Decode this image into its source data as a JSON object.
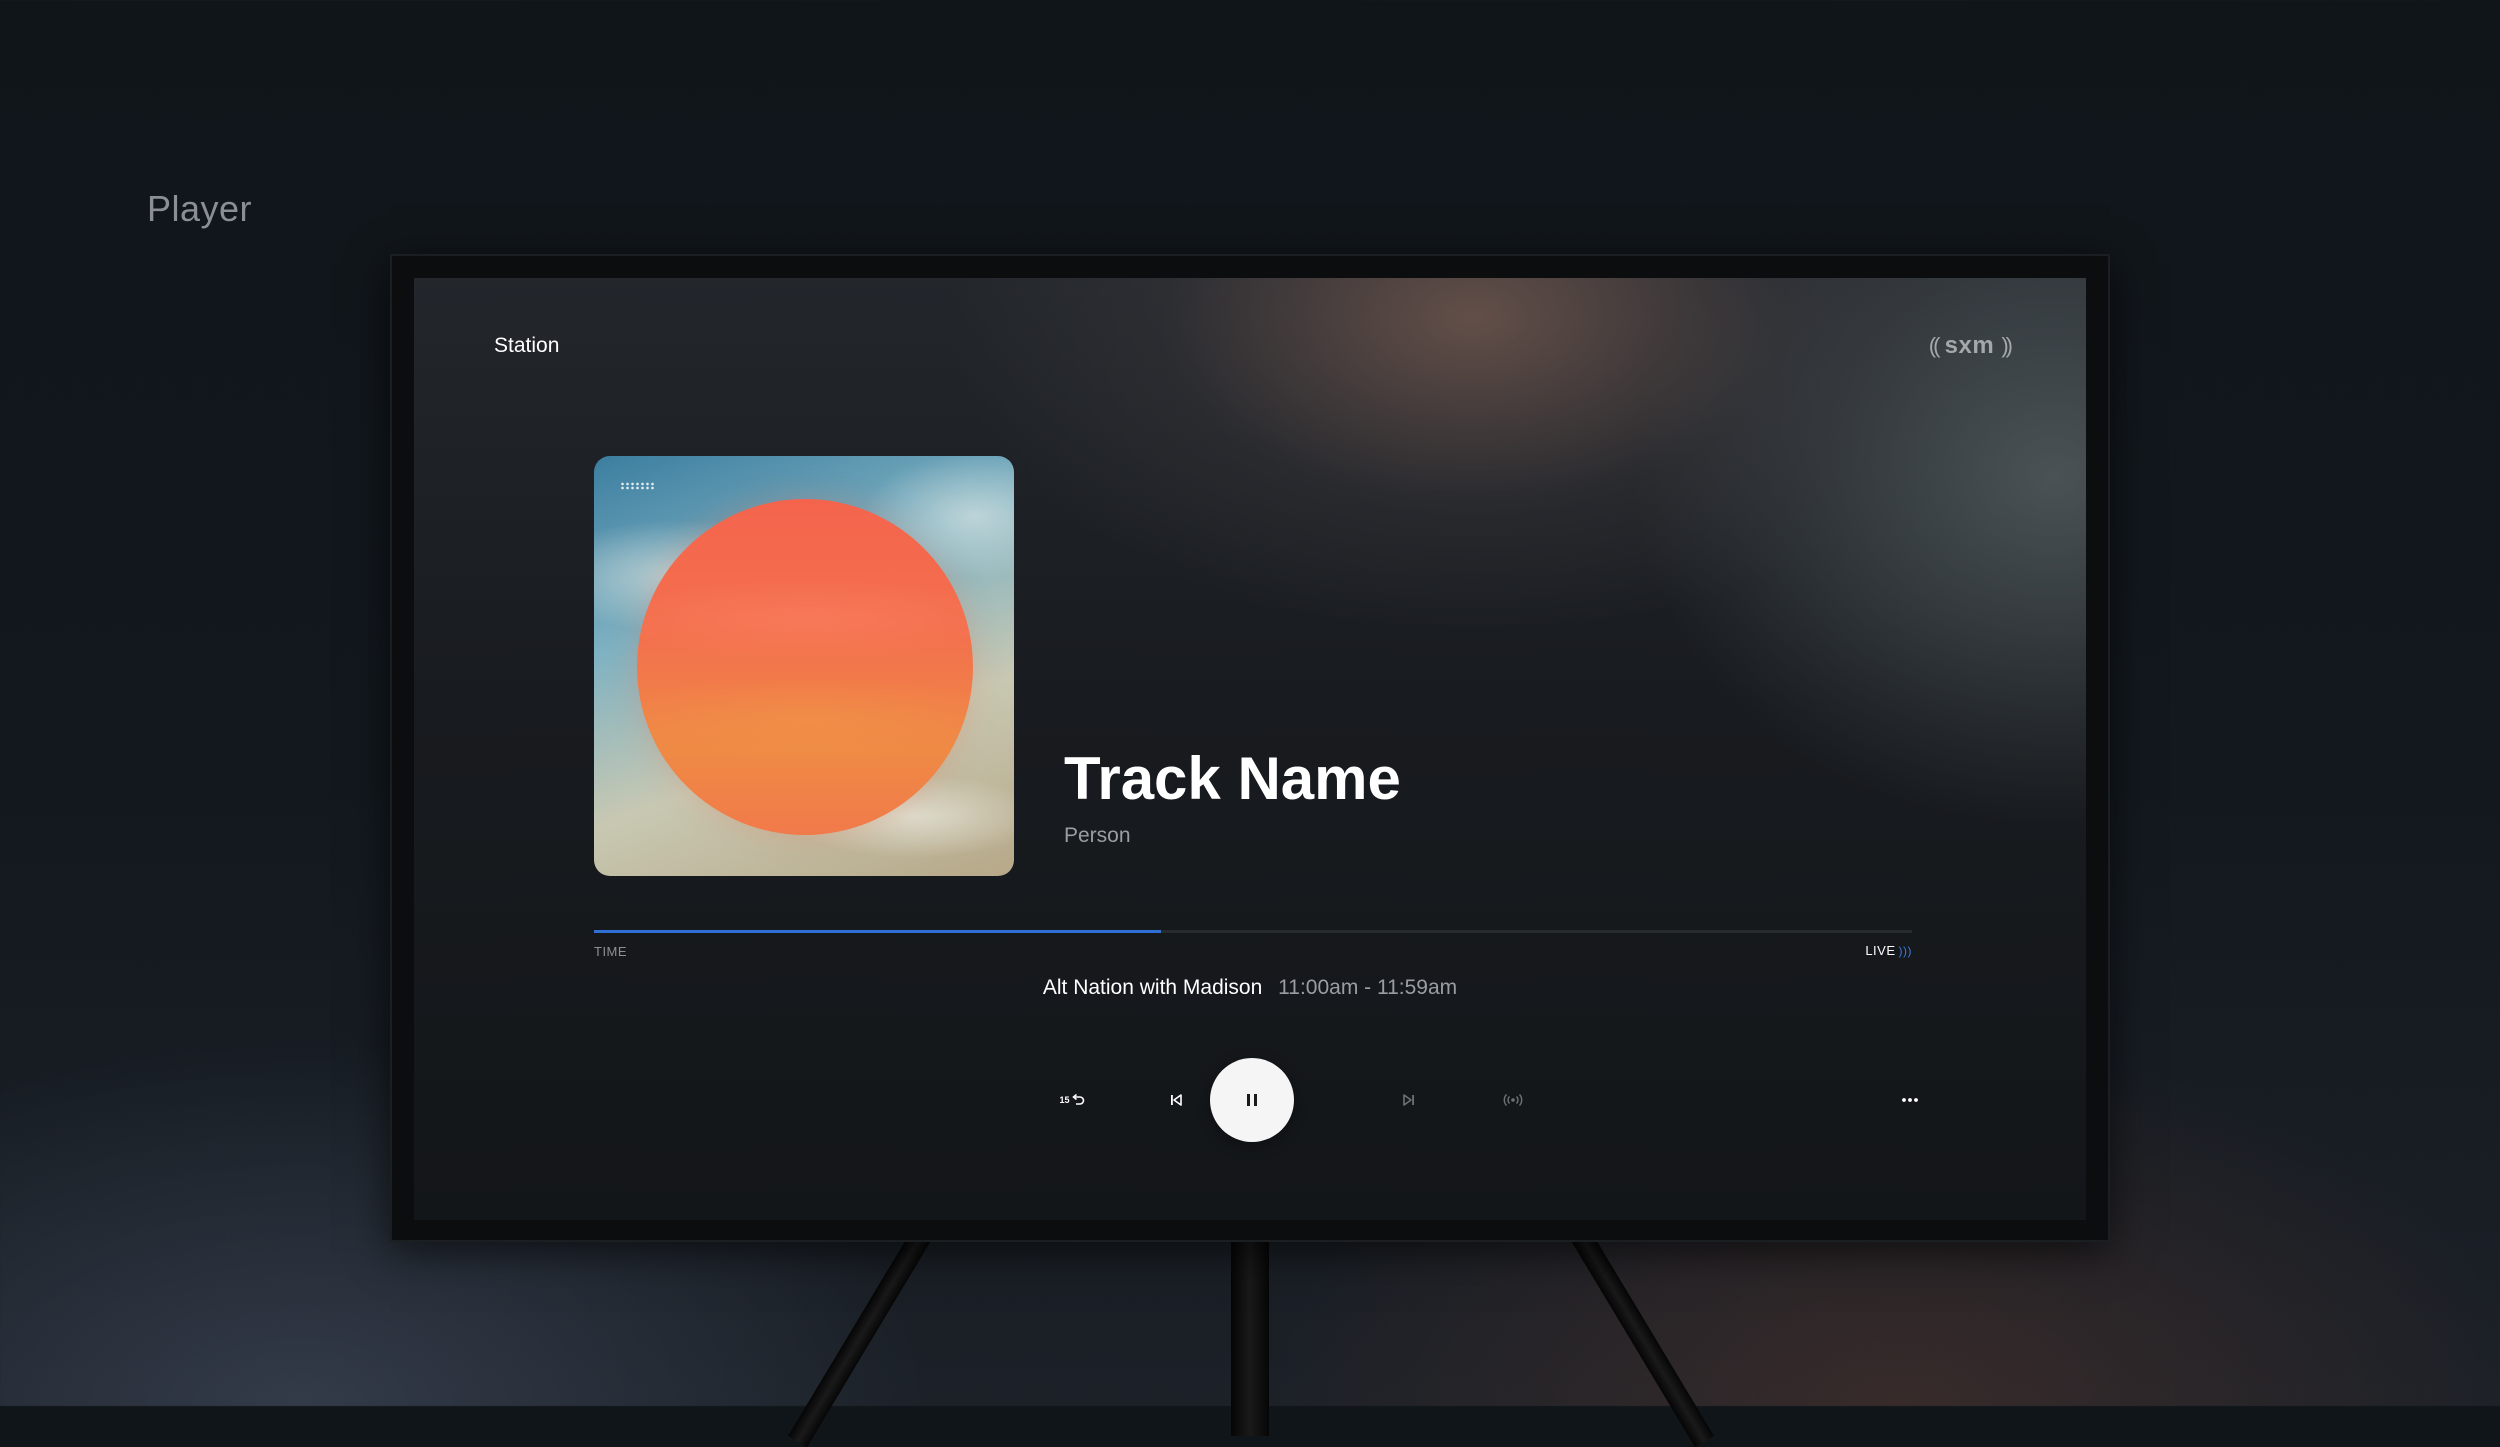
{
  "page": {
    "title": "Player"
  },
  "header": {
    "station_label": "Station",
    "logo_text": "sxm",
    "logo_wave_left": "((",
    "logo_wave_right": "))"
  },
  "now_playing": {
    "track_name": "Track Name",
    "artist_name": "Person",
    "progress_fraction": 0.43
  },
  "timeline": {
    "time_label": "TIME",
    "live_label": "LIVE",
    "live_icon": "broadcast-wave-icon"
  },
  "show": {
    "name": "Alt Nation with Madison",
    "time": "11:00am - 11:59am"
  },
  "controls": {
    "replay_amount": "15",
    "replay_icon": "rewind-15-icon",
    "previous_icon": "skip-previous-icon",
    "pause_icon": "pause-icon",
    "next_icon": "skip-next-icon",
    "live_icon": "go-live-icon",
    "more_icon": "more-options-icon"
  },
  "colors": {
    "accent": "#2f6fd6",
    "disabled": "#6d7176"
  }
}
